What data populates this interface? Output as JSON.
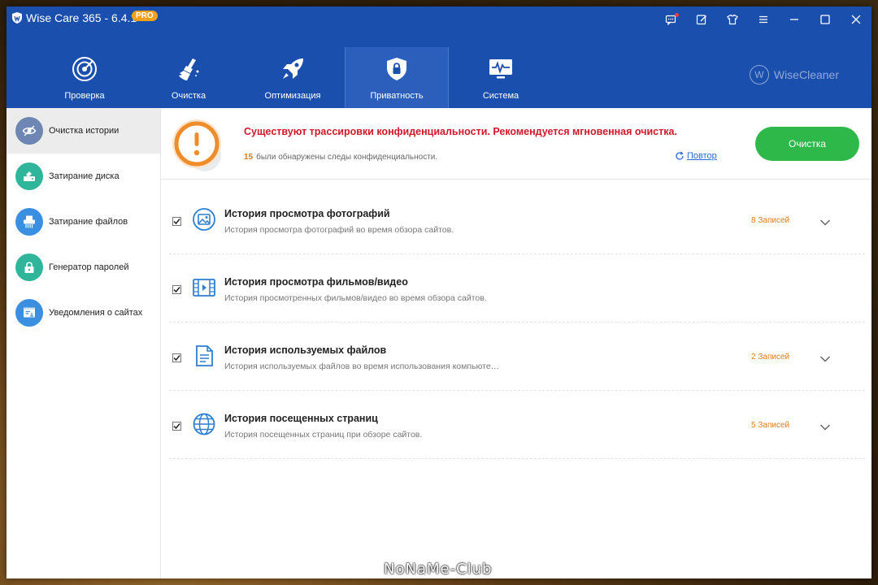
{
  "app": {
    "title": "Wise Care 365 - 6.4.1",
    "badge": "PRO",
    "brand": "WiseCleaner",
    "brand_letter": "W"
  },
  "titlebar_icons": [
    "messages-icon",
    "feedback-icon",
    "skin-icon",
    "menu-icon",
    "minimize-icon",
    "maximize-icon",
    "close-icon"
  ],
  "nav": {
    "tabs": [
      {
        "label": "Проверка",
        "icon": "radar-icon"
      },
      {
        "label": "Очистка",
        "icon": "broom-icon"
      },
      {
        "label": "Оптимизация",
        "icon": "rocket-icon"
      },
      {
        "label": "Приватность",
        "icon": "shield-lock-icon",
        "active": true
      },
      {
        "label": "Система",
        "icon": "monitor-pulse-icon"
      }
    ]
  },
  "sidebar": {
    "items": [
      {
        "label": "Очистка истории",
        "icon": "eye-off-icon",
        "color": "#6d86b3",
        "active": true
      },
      {
        "label": "Затирание диска",
        "icon": "disk-wipe-icon",
        "color": "#2fb69a"
      },
      {
        "label": "Затирание файлов",
        "icon": "shredder-icon",
        "color": "#3a8fe0"
      },
      {
        "label": "Генератор паролей",
        "icon": "lock-icon",
        "color": "#2fb69a"
      },
      {
        "label": "Уведомления о сайтах",
        "icon": "web-notify-icon",
        "color": "#3a8fe0"
      }
    ]
  },
  "alert": {
    "title": "Существуют трассировки конфиденциальности. Рекомендуется мгновенная очистка.",
    "count": "15",
    "subtitle": "были обнаружены следы конфиденциальности.",
    "retry": "Повтор",
    "clean_button": "Очистка"
  },
  "items": [
    {
      "title": "История просмотра фотографий",
      "desc": "История просмотра фотографий во время обзора сайтов.",
      "count": "8 Записей",
      "checked": true,
      "icon": "image-icon"
    },
    {
      "title": "История просмотра фильмов/видео",
      "desc": "История просмотренных фильмов/видео во время обзора сайтов.",
      "count": "",
      "checked": true,
      "icon": "film-icon"
    },
    {
      "title": "История используемых файлов",
      "desc": "История используемых файлов во время использования компьюте…",
      "count": "2 Записей",
      "checked": true,
      "icon": "document-icon"
    },
    {
      "title": "История посещенных страниц",
      "desc": "История посещенных страниц при обзоре сайтов.",
      "count": "5 Записей",
      "checked": true,
      "icon": "globe-icon"
    }
  ],
  "watermark": "NoNaMe-Club",
  "colors": {
    "header": "#1a4fae",
    "accent_green": "#2eb84a",
    "alert_red": "#d0182a",
    "count_orange": "#e07b14"
  }
}
